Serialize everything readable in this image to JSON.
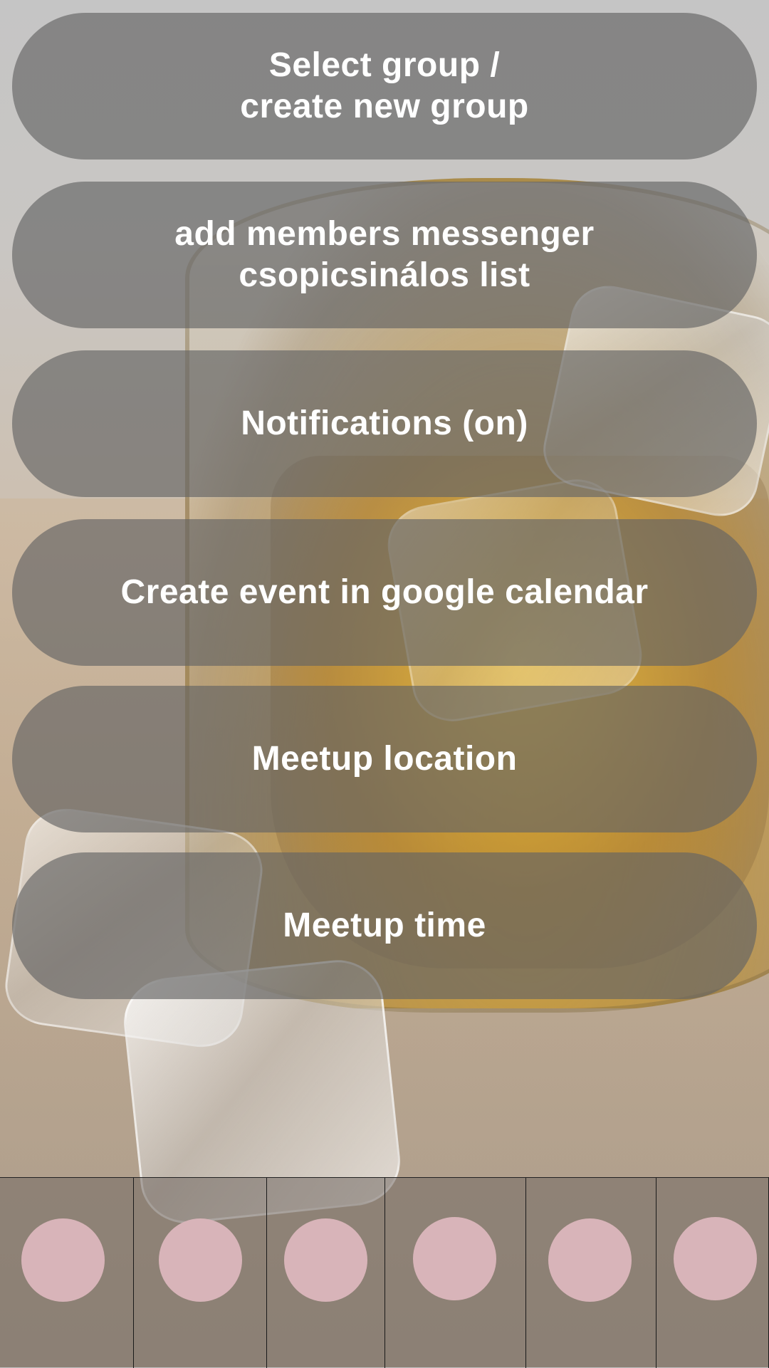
{
  "menu": {
    "items": [
      {
        "label_line1": "Select group /",
        "label_line2": "create new group"
      },
      {
        "label_line1": "add members messenger",
        "label_line2": "csopicsinálos list"
      },
      {
        "label_line1": "Notifications (on)",
        "label_line2": ""
      },
      {
        "label_line1": "Create event in google calendar",
        "label_line2": ""
      },
      {
        "label_line1": "Meetup location",
        "label_line2": ""
      },
      {
        "label_line1": "Meetup time",
        "label_line2": ""
      }
    ],
    "button_color": "#646464",
    "text_color": "#ffffff"
  },
  "bottom_bar": {
    "buttons": [
      {
        "name": "circle-button-1"
      },
      {
        "name": "circle-button-2"
      },
      {
        "name": "circle-button-3"
      },
      {
        "name": "circle-button-4"
      },
      {
        "name": "circle-button-5"
      },
      {
        "name": "circle-button-6"
      }
    ],
    "circle_color": "#d8b4b9"
  }
}
